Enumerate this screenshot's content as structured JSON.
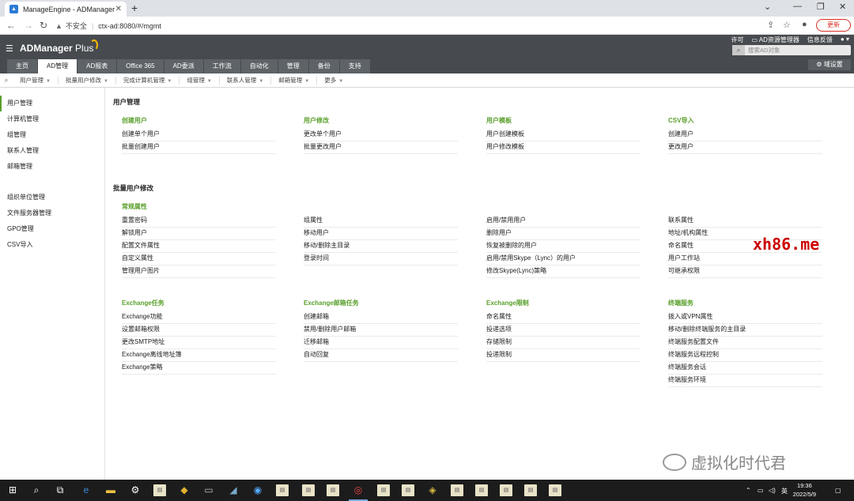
{
  "browser": {
    "tab_title": "ManageEngine - ADManager",
    "new_tab_icon": "plus-icon",
    "url_insecure_label": "不安全",
    "url": "ctx-ad:8080/#/mgmt",
    "update_button": "更新"
  },
  "app": {
    "logo": "ADManager",
    "logo_plus": "Plus",
    "top_links": [
      "许可",
      "AD资源管理器",
      "信息反馈"
    ],
    "search_placeholder": "搜索AD对象",
    "domain_settings": "域设置",
    "main_nav": [
      "主页",
      "AD管理",
      "AD报表",
      "Office 365",
      "AD委派",
      "工作流",
      "自动化",
      "管理",
      "备份",
      "支持"
    ],
    "main_nav_active": "AD管理",
    "sub_nav": [
      "用户管理",
      "批量用户修改",
      "完成计算机管理",
      "组管理",
      "联系人管理",
      "邮箱管理",
      "更多"
    ]
  },
  "sidebar": {
    "group1": [
      "用户管理",
      "计算机管理",
      "组管理",
      "联系人管理",
      "邮箱管理"
    ],
    "group2": [
      "组织单位管理",
      "文件服务器管理",
      "GPO管理",
      "CSV导入"
    ],
    "active": "用户管理"
  },
  "content": {
    "section1_title": "用户管理",
    "section1_cols": [
      {
        "head": "创建用户",
        "links": [
          "创建单个用户",
          "批量创建用户"
        ]
      },
      {
        "head": "用户修改",
        "links": [
          "更改单个用户",
          "批量更改用户"
        ]
      },
      {
        "head": "用户模板",
        "links": [
          "用户创建模板",
          "用户修改模板"
        ]
      },
      {
        "head": "CSV导入",
        "links": [
          "创建用户",
          "更改用户"
        ]
      }
    ],
    "section2_title": "批量用户修改",
    "section2_cols": [
      {
        "head": "常规属性",
        "links": [
          "重置密码",
          "解锁用户",
          "配置文件属性",
          "自定义属性",
          "管理用户图片"
        ]
      },
      {
        "head": "",
        "links": [
          "组属性",
          "移动用户",
          "移动/删除主目录",
          "登录时间"
        ]
      },
      {
        "head": "",
        "links": [
          "启用/禁用用户",
          "删除用户",
          "恢复被删除的用户",
          "启用/禁用Skype（Lync）的用户",
          "修改Skype(Lync)策略"
        ]
      },
      {
        "head": "",
        "links": [
          "联系属性",
          "地址/机构属性",
          "命名属性",
          "用户工作站",
          "可继承权限"
        ]
      }
    ],
    "section3_cols": [
      {
        "head": "Exchange任务",
        "links": [
          "Exchange功能",
          "设置邮箱权限",
          "更改SMTP地址",
          "Exchange离线地址簿",
          "Exchange策略"
        ]
      },
      {
        "head": "Exchange邮箱任务",
        "links": [
          "创建邮箱",
          "禁用/删除用户邮箱",
          "迁移邮箱",
          "自动回复"
        ]
      },
      {
        "head": "Exchange限制",
        "links": [
          "命名属性",
          "投递选项",
          "存储限制",
          "投递限制"
        ]
      },
      {
        "head": "终端服务",
        "links": [
          "拨入或VPN属性",
          "移动/删除终端服务的主目录",
          "终端服务配置文件",
          "终端服务远程控制",
          "终端服务会话",
          "终端服务环境"
        ]
      }
    ]
  },
  "watermarks": {
    "red": "xh86.me",
    "grey": "虚拟化时代君"
  },
  "taskbar": {
    "time": "19:36",
    "date": "2022/5/9",
    "ime": "英"
  }
}
